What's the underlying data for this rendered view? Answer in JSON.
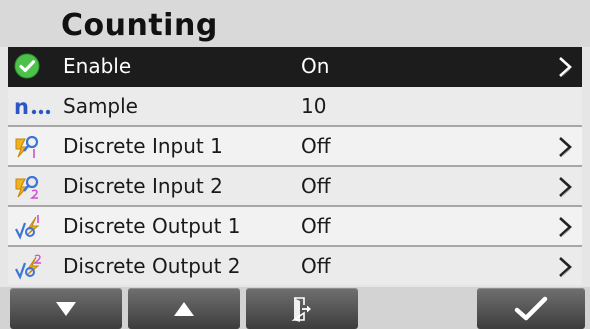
{
  "header": {
    "title": "Counting"
  },
  "rows": [
    {
      "label": "Enable",
      "value": "On",
      "icon": "checkmark-circle-icon",
      "has_submenu": true,
      "selected": true
    },
    {
      "label": "Sample",
      "value": "10",
      "icon": "sample-n-icon",
      "has_submenu": false,
      "selected": false
    },
    {
      "label": "Discrete Input 1",
      "value": "Off",
      "icon": "discrete-input-1-icon",
      "has_submenu": true,
      "selected": false
    },
    {
      "label": "Discrete Input 2",
      "value": "Off",
      "icon": "discrete-input-2-icon",
      "has_submenu": true,
      "selected": false
    },
    {
      "label": "Discrete Output 1",
      "value": "Off",
      "icon": "discrete-output-1-icon",
      "has_submenu": true,
      "selected": false
    },
    {
      "label": "Discrete Output 2",
      "value": "Off",
      "icon": "discrete-output-2-icon",
      "has_submenu": true,
      "selected": false
    }
  ],
  "softkeys": [
    {
      "icon": "arrow-down-icon"
    },
    {
      "icon": "arrow-up-icon"
    },
    {
      "icon": "exit-door-icon"
    },
    {
      "icon": "checkmark-icon"
    }
  ],
  "colors": {
    "selected_row": "#1c1c1c",
    "check_green": "#4cc24a",
    "sample_blue": "#2a56c8",
    "softkey": "#505050"
  }
}
